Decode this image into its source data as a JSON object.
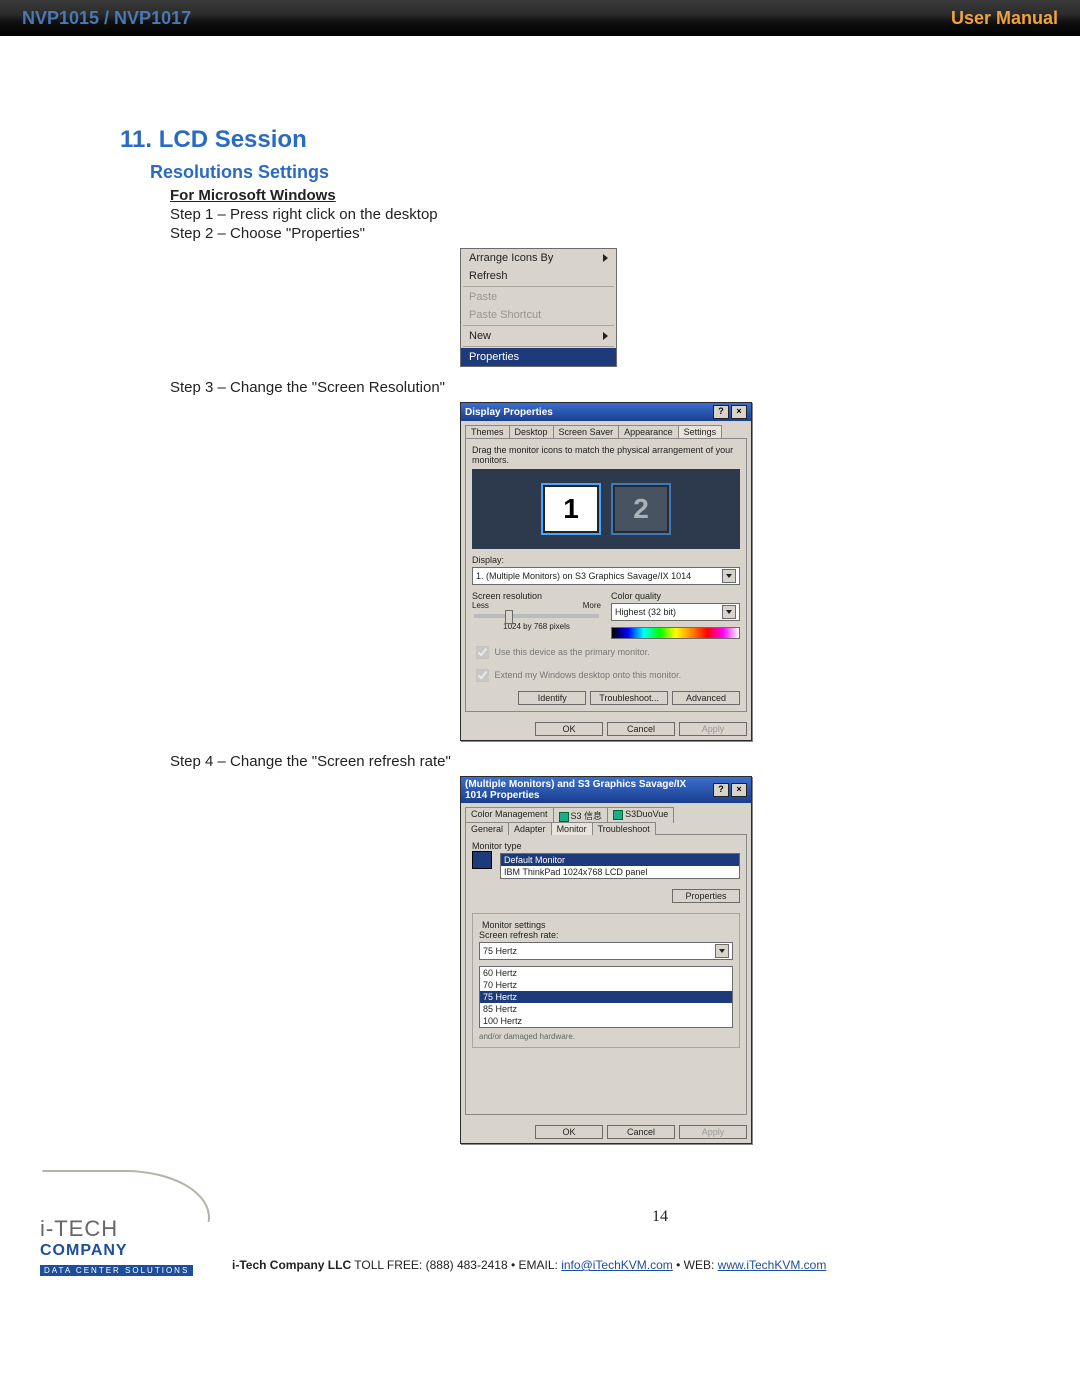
{
  "header": {
    "left": "NVP1015 / NVP1017",
    "right": "User Manual"
  },
  "section": {
    "number_title": "11. LCD Session",
    "sub": "Resolutions Settings",
    "os": "For Microsoft Windows"
  },
  "steps": {
    "s1": "Step 1 – Press right click on the desktop",
    "s2": "Step 2 – Choose \"Properties\"",
    "s3": "Step 3 – Change the \"Screen Resolution\"",
    "s4": "Step 4 – Change the \"Screen refresh rate\""
  },
  "ctxmenu": {
    "arrange": "Arrange Icons By",
    "refresh": "Refresh",
    "paste": "Paste",
    "paste_shortcut": "Paste Shortcut",
    "new": "New",
    "properties": "Properties"
  },
  "dispprops": {
    "title": "Display Properties",
    "tabs": {
      "themes": "Themes",
      "desktop": "Desktop",
      "saver": "Screen Saver",
      "appearance": "Appearance",
      "settings": "Settings"
    },
    "hint": "Drag the monitor icons to match the physical arrangement of your monitors.",
    "mon1": "1",
    "mon2": "2",
    "display_label": "Display:",
    "display_value": "1. (Multiple Monitors) on S3 Graphics Savage/IX 1014",
    "res_label": "Screen resolution",
    "less": "Less",
    "more": "More",
    "res_value": "1024 by 768 pixels",
    "cq_label": "Color quality",
    "cq_value": "Highest (32 bit)",
    "chk1": "Use this device as the primary monitor.",
    "chk2": "Extend my Windows desktop onto this monitor.",
    "identify": "Identify",
    "troubleshoot": "Troubleshoot...",
    "advanced": "Advanced",
    "ok": "OK",
    "cancel": "Cancel",
    "apply": "Apply"
  },
  "monprops": {
    "title": "(Multiple Monitors) and S3 Graphics Savage/IX 1014 Properties",
    "tabs_row1": {
      "colormgmt": "Color Management",
      "s3info": "S3 信息",
      "s3duo": "S3DuoVue"
    },
    "tabs_row2": {
      "general": "General",
      "adapter": "Adapter",
      "monitor": "Monitor",
      "troubleshoot": "Troubleshoot"
    },
    "montype": "Monitor type",
    "mlist1": "Default Monitor",
    "mlist2": "IBM ThinkPad 1024x768 LCD panel",
    "properties": "Properties",
    "msettings": "Monitor settings",
    "rrlabel": "Screen refresh rate:",
    "rr_selected": "75 Hertz",
    "rr_opts": [
      "60 Hertz",
      "70 Hertz",
      "75 Hertz",
      "85 Hertz",
      "100 Hertz"
    ],
    "note": "and/or damaged hardware.",
    "ok": "OK",
    "cancel": "Cancel",
    "apply": "Apply"
  },
  "footer": {
    "company_line": "i-Tech Company LLC",
    "toll": " TOLL FREE: (888) 483-2418 • EMAIL: ",
    "email": "info@iTechKVM.com",
    "webpre": " • WEB: ",
    "web": "www.iTechKVM.com",
    "logo_top": "i-TECH",
    "logo_company": "COMPANY",
    "logo_sub": "DATA CENTER SOLUTIONS",
    "pagenum": "14"
  }
}
